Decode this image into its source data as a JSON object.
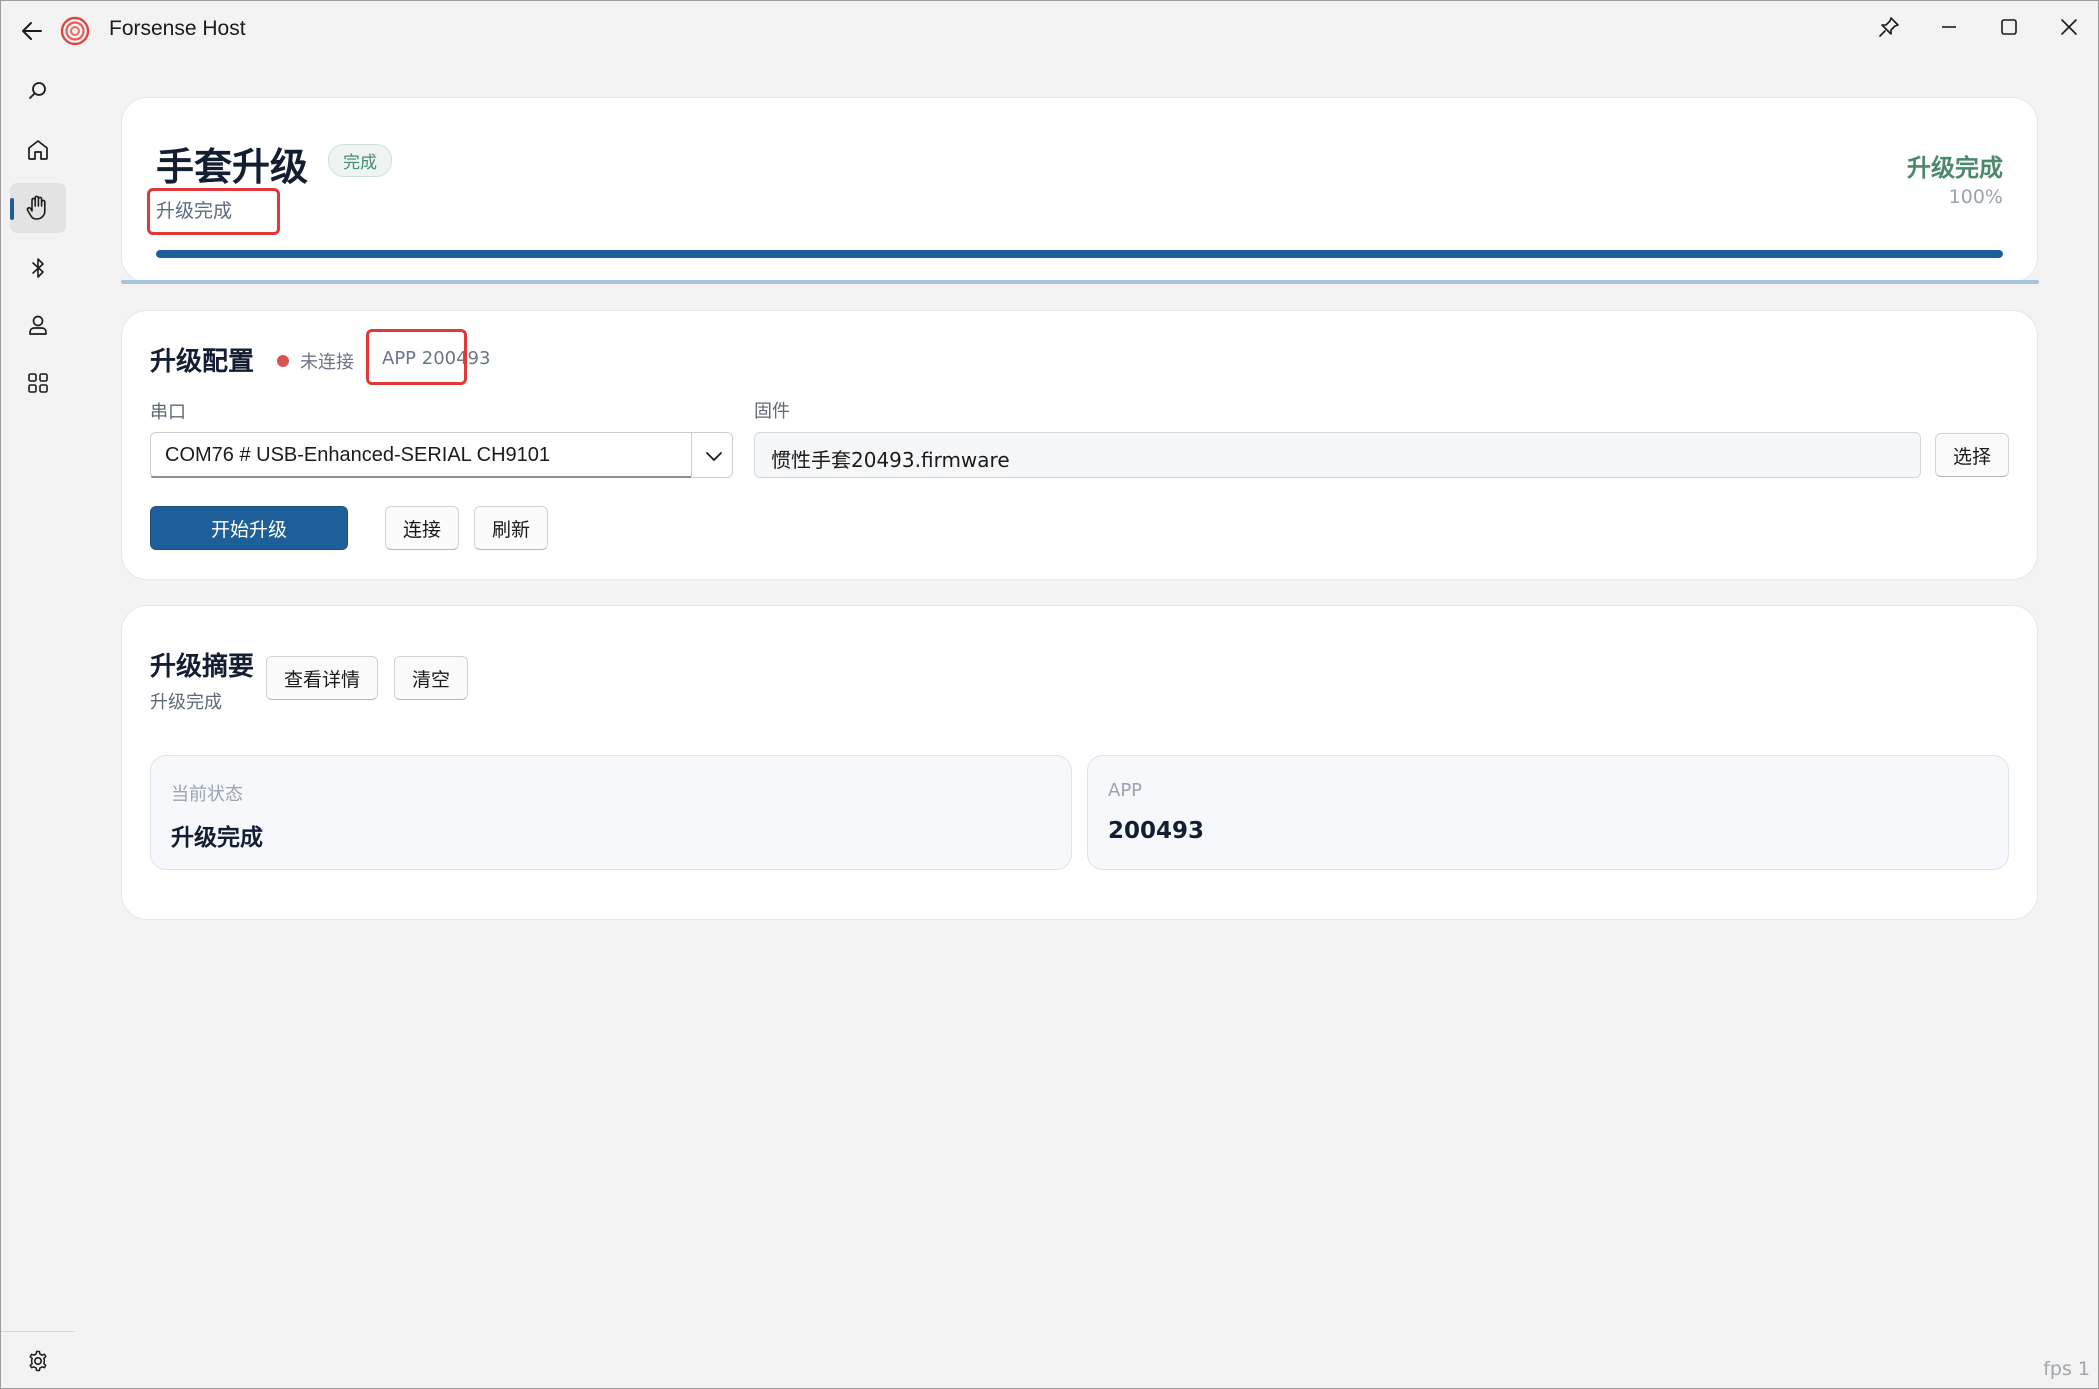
{
  "window": {
    "title": "Forsense Host"
  },
  "header": {
    "title": "手套升级",
    "badge": "完成",
    "subtitle": "升级完成",
    "status": "升级完成",
    "percent_label": "100%",
    "progress": 1.0
  },
  "config": {
    "title": "升级配置",
    "connection_status": "未连接",
    "app_version": "APP 200493",
    "port_label": "串口",
    "port_value": "COM76 # USB-Enhanced-SERIAL CH9101",
    "firmware_label": "固件",
    "firmware_value": "惯性手套20493.firmware",
    "choose_button": "选择",
    "start_button": "开始升级",
    "connect_button": "连接",
    "refresh_button": "刷新"
  },
  "summary": {
    "title": "升级摘要",
    "subtitle": "升级完成",
    "details_button": "查看详情",
    "clear_button": "清空",
    "stats": [
      {
        "label": "当前状态",
        "value": "升级完成"
      },
      {
        "label": "APP",
        "value": "200493"
      }
    ]
  },
  "footer": {
    "fps": "fps 1"
  },
  "colors": {
    "accent": "#1f5f99",
    "success": "#4a8a6a",
    "disconnected": "#d9534f",
    "highlight": "#e0393b"
  }
}
